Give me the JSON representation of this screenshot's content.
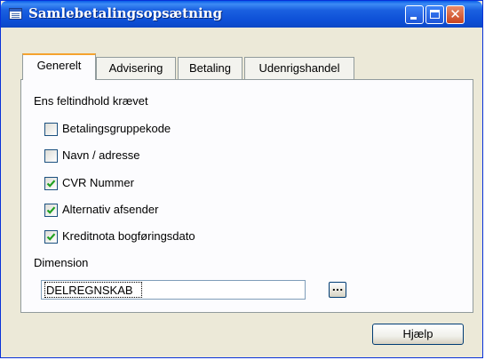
{
  "window": {
    "title": "Samlebetalingsopsætning"
  },
  "tabs": [
    {
      "label": "Generelt",
      "active": true
    },
    {
      "label": "Advisering",
      "active": false
    },
    {
      "label": "Betaling",
      "active": false
    },
    {
      "label": "Udenrigshandel",
      "active": false
    }
  ],
  "general": {
    "group_label": "Ens feltindhold krævet",
    "checkboxes": [
      {
        "label": "Betalingsgruppekode",
        "checked": false
      },
      {
        "label": "Navn / adresse",
        "checked": false
      },
      {
        "label": "CVR Nummer",
        "checked": true
      },
      {
        "label": "Alternativ afsender",
        "checked": true
      },
      {
        "label": "Kreditnota bogføringsdato",
        "checked": true
      }
    ],
    "dimension_label": "Dimension",
    "dimension_value": "DELREGNSKAB",
    "lookup_label": "..."
  },
  "buttons": {
    "help": "Hjælp"
  }
}
